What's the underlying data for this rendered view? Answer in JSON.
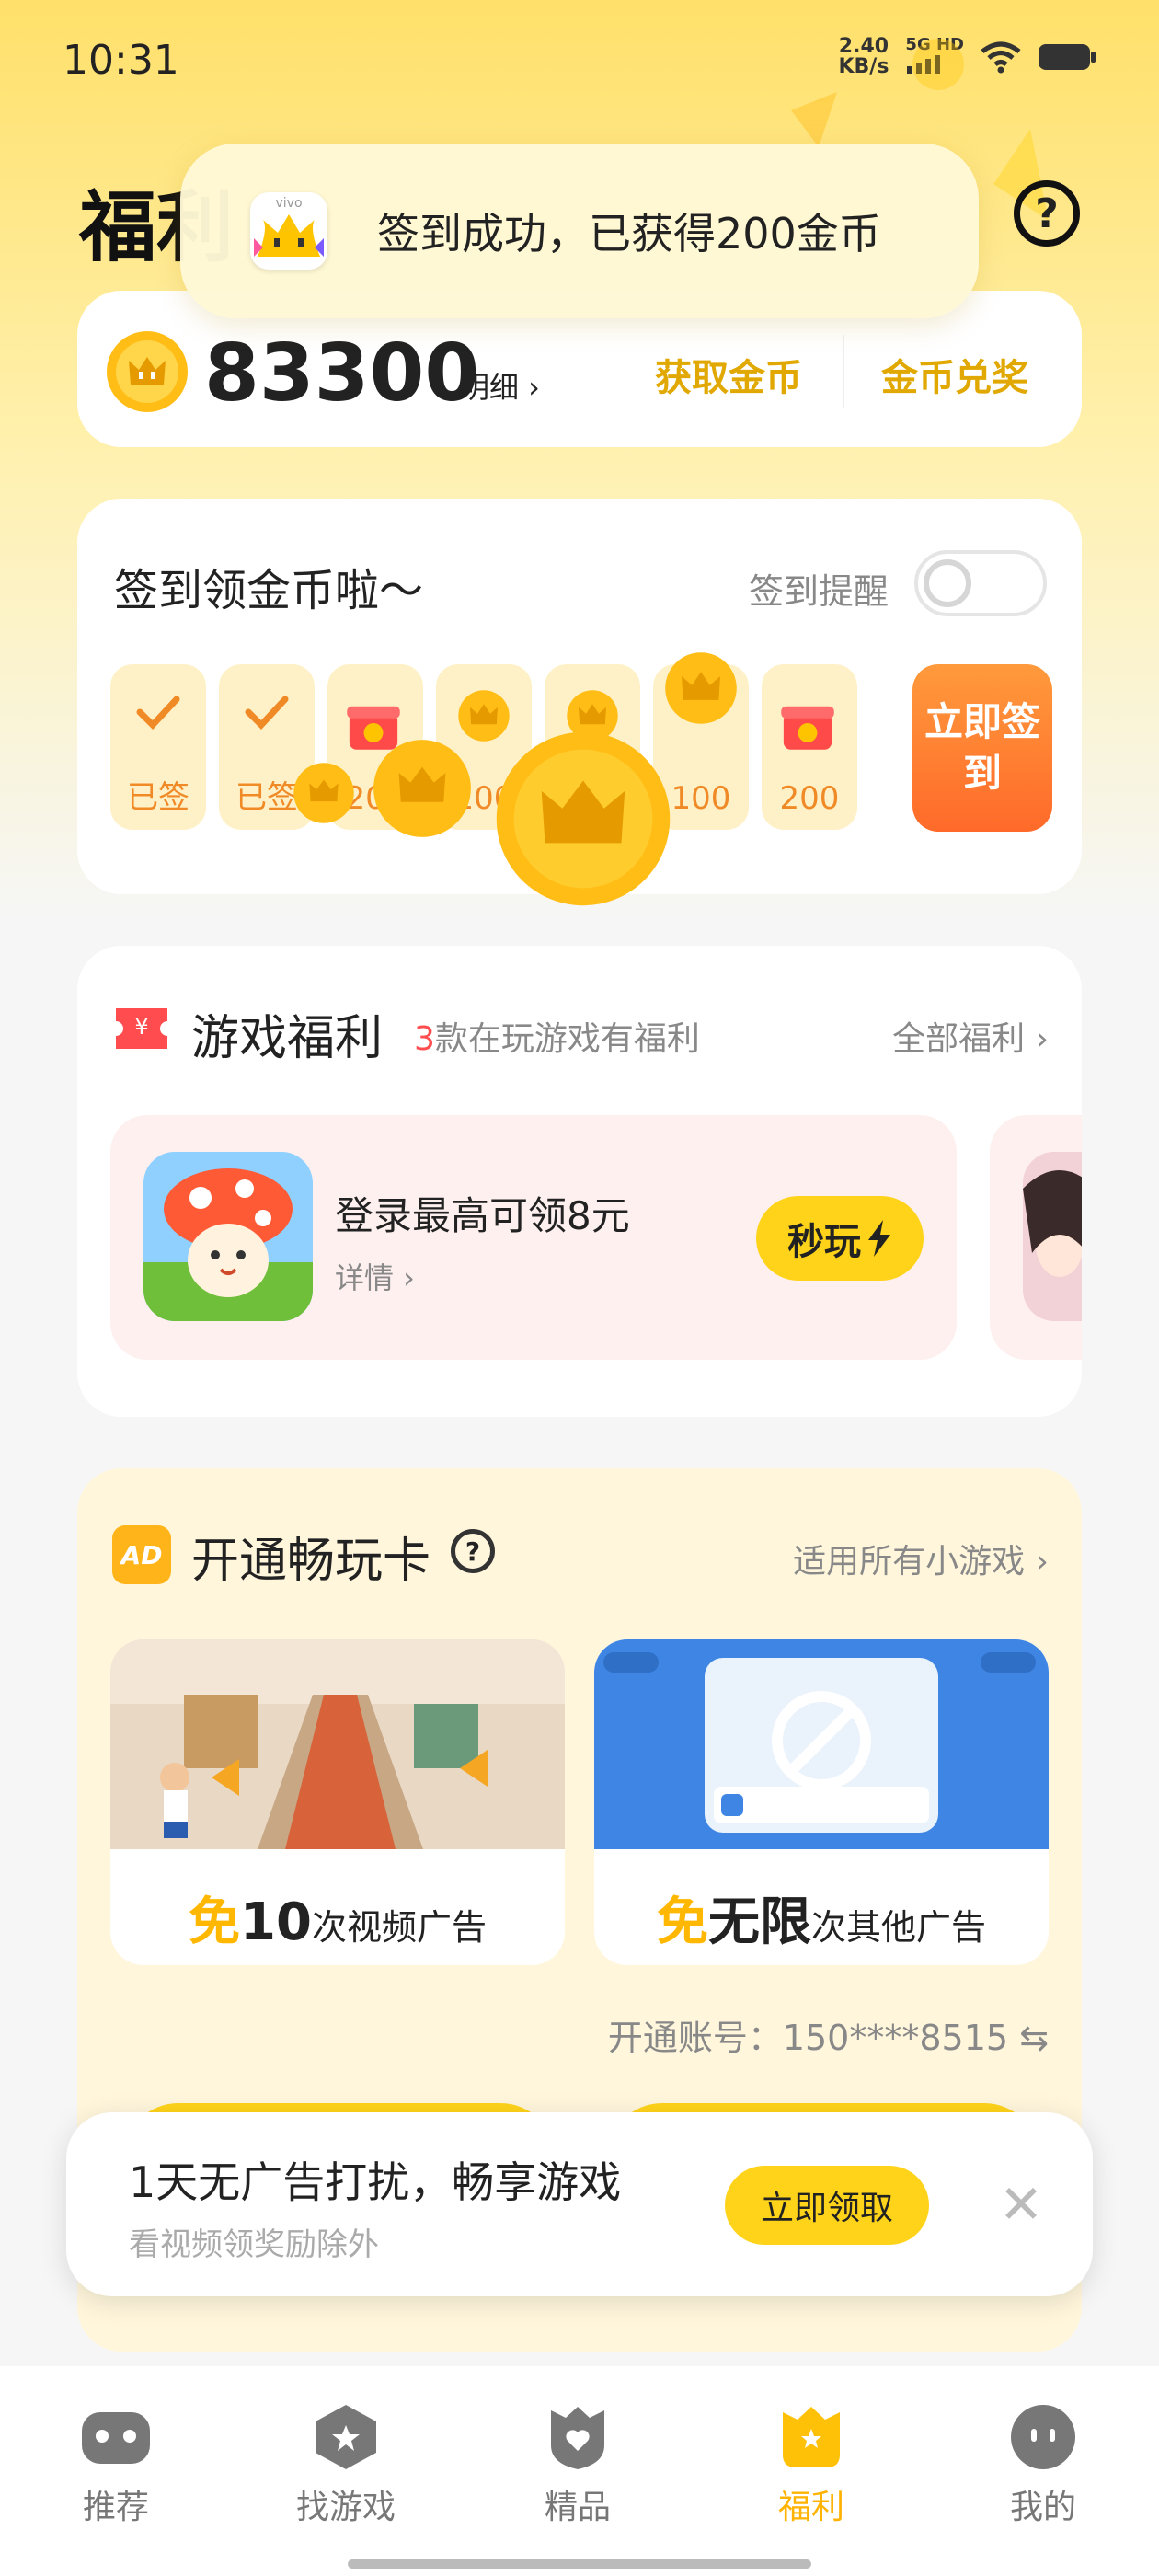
{
  "status": {
    "time": "10:31",
    "speed_value": "2.40",
    "speed_unit": "KB/s",
    "network": "5G HD"
  },
  "header": {
    "title": "福利",
    "help": "?"
  },
  "toast": {
    "brand": "vivo",
    "message": "签到成功，已获得200金币"
  },
  "coins": {
    "total": "83300",
    "detail_link": "明细 ›",
    "get_coins": "获取金币",
    "redeem": "金币兑奖"
  },
  "checkin": {
    "title": "签到领金币啦～",
    "remind_label": "签到提醒",
    "remind_on": false,
    "days": [
      {
        "label": "已签",
        "state": "signed"
      },
      {
        "label": "已签",
        "state": "signed"
      },
      {
        "label": "200",
        "state": "gift"
      },
      {
        "label": "100",
        "state": "coin"
      },
      {
        "label": "100",
        "state": "coin"
      },
      {
        "label": "100",
        "state": "coin"
      },
      {
        "label": "200",
        "state": "gift"
      }
    ],
    "sign_button": "立即签到"
  },
  "game_welfare": {
    "title": "游戏福利",
    "sub_count": "3",
    "sub_text": "款在玩游戏有福利",
    "all_link": "全部福利 ›",
    "promo": {
      "title": "登录最高可领8元",
      "detail": "详情 ›",
      "play_button": "秒玩",
      "play_icon": "lightning-icon"
    }
  },
  "adfree": {
    "logo": "AD",
    "title": "开通畅玩卡",
    "help": "?",
    "link": "适用所有小游戏 ›",
    "benefits": [
      {
        "prefix": "免",
        "value": "10",
        "suffix": "次视频广告"
      },
      {
        "prefix": "免",
        "value": "无限",
        "suffix": "次其他广告"
      }
    ],
    "account": "开通账号：150****8515 ⇆"
  },
  "banner": {
    "title": "1天无广告打扰，畅享游戏",
    "sub": "看视频领奖励除外",
    "claim": "立即领取",
    "close": "✕"
  },
  "nav": [
    {
      "label": "推荐",
      "icon": "gamepad-icon",
      "active": false
    },
    {
      "label": "找游戏",
      "icon": "star-hexagon-icon",
      "active": false
    },
    {
      "label": "精品",
      "icon": "shield-heart-icon",
      "active": false
    },
    {
      "label": "福利",
      "icon": "gift-crown-icon",
      "active": true
    },
    {
      "label": "我的",
      "icon": "face-icon",
      "active": false
    }
  ],
  "colors": {
    "accent": "#ffd31a",
    "gold_text": "#e0a800",
    "orange": "#ff6a2a",
    "red": "#ff4d4f"
  }
}
